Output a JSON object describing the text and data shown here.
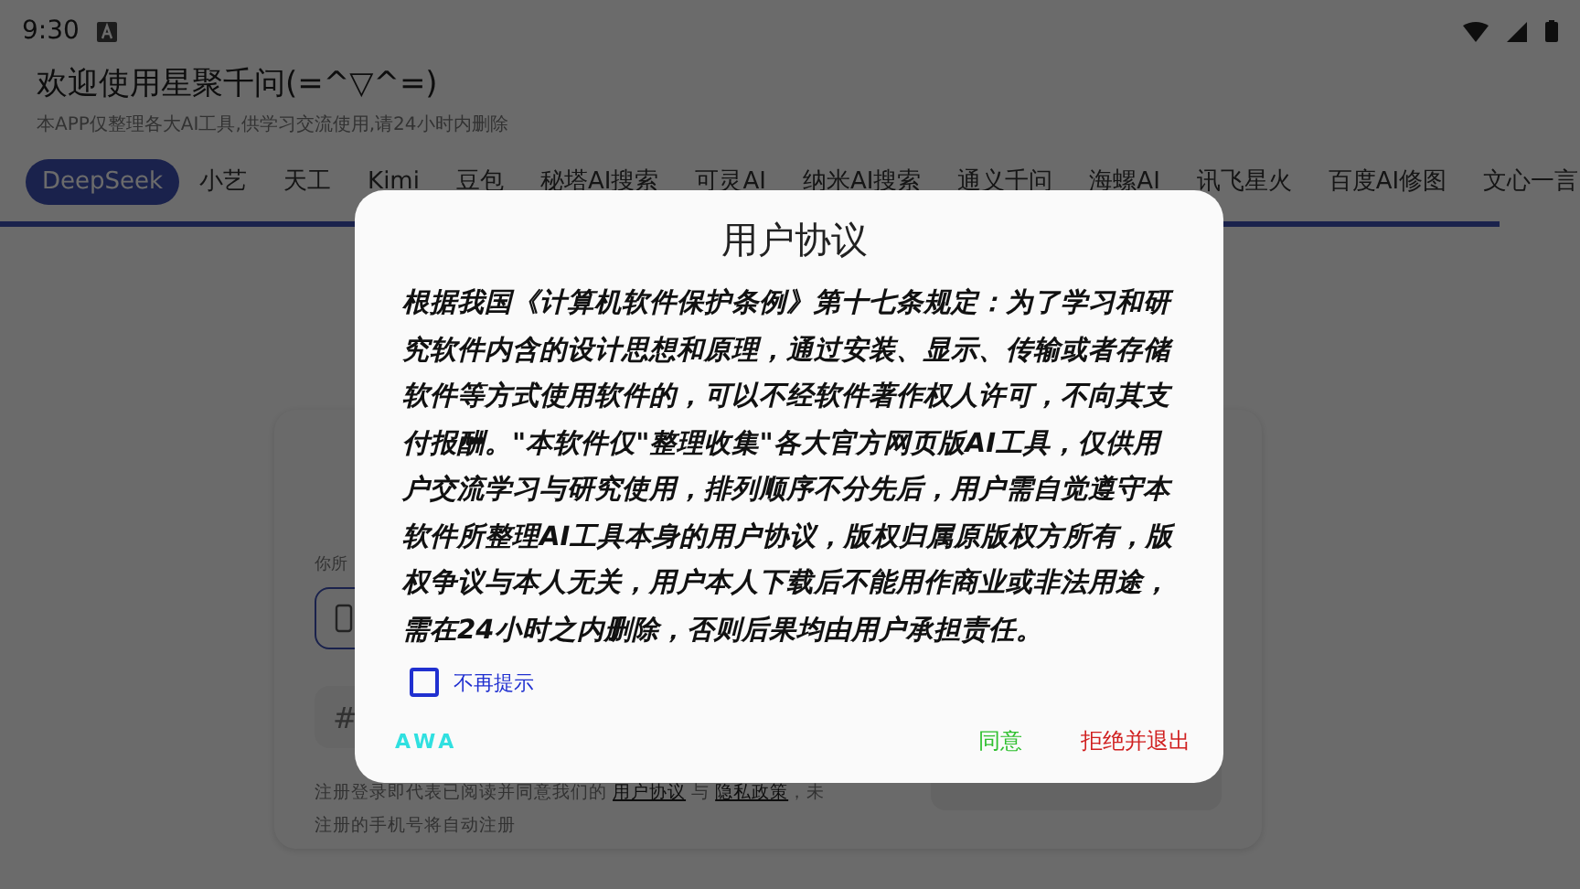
{
  "status_bar": {
    "time": "9:30"
  },
  "header": {
    "title": "欢迎使用星聚千问(=^▽^=)",
    "subtitle": "本APP仅整理各大AI工具,供学习交流使用,请24小时内删除"
  },
  "tabs": [
    {
      "label": "DeepSeek",
      "selected": true
    },
    {
      "label": "小艺",
      "selected": false
    },
    {
      "label": "天工",
      "selected": false
    },
    {
      "label": "Kimi",
      "selected": false
    },
    {
      "label": "豆包",
      "selected": false
    },
    {
      "label": "秘塔AI搜索",
      "selected": false
    },
    {
      "label": "可灵AI",
      "selected": false
    },
    {
      "label": "纳米AI搜索",
      "selected": false
    },
    {
      "label": "通义千问",
      "selected": false
    },
    {
      "label": "海螺AI",
      "selected": false
    },
    {
      "label": "讯飞星火",
      "selected": false
    },
    {
      "label": "百度AI修图",
      "selected": false
    },
    {
      "label": "文心一言",
      "selected": false
    }
  ],
  "login_card": {
    "label": "你所",
    "code_field": {
      "placeholder": "#"
    },
    "footer": [
      {
        "kind": "plain",
        "text": "注册登录即代表已阅读并同意我们的 "
      },
      {
        "kind": "link",
        "text": "用户协议"
      },
      {
        "kind": "plain",
        "text": " 与 "
      },
      {
        "kind": "link",
        "text": "隐私政策"
      },
      {
        "kind": "plain",
        "text": "，未注册的手机号将自动注册"
      }
    ]
  },
  "dialog": {
    "title": "用户协议",
    "body": "根据我国《计算机软件保护条例》第十七条规定：为了学习和研究软件内含的设计思想和原理，通过安装、显示、传输或者存储软件等方式使用软件的，可以不经软件著作权人许可，不向其支付报酬。\"本软件仅\"整理收集\"各大官方网页版AI工具，仅供用户交流学习与研究使用，排列顺序不分先后，用户需自觉遵守本软件所整理AI工具本身的用户协议，版权归属原版权方所有，版权争议与本人无关，用户本人下载后不能用作商业或非法用途，需在24小时之内删除，否则后果均由用户承担责任。",
    "checkbox": {
      "label": "不再提示",
      "checked": false
    },
    "footer_note": "AWA",
    "buttons": [
      {
        "label": "同意",
        "kind": "agree"
      },
      {
        "label": "拒绝并退出",
        "kind": "decline"
      }
    ]
  }
}
